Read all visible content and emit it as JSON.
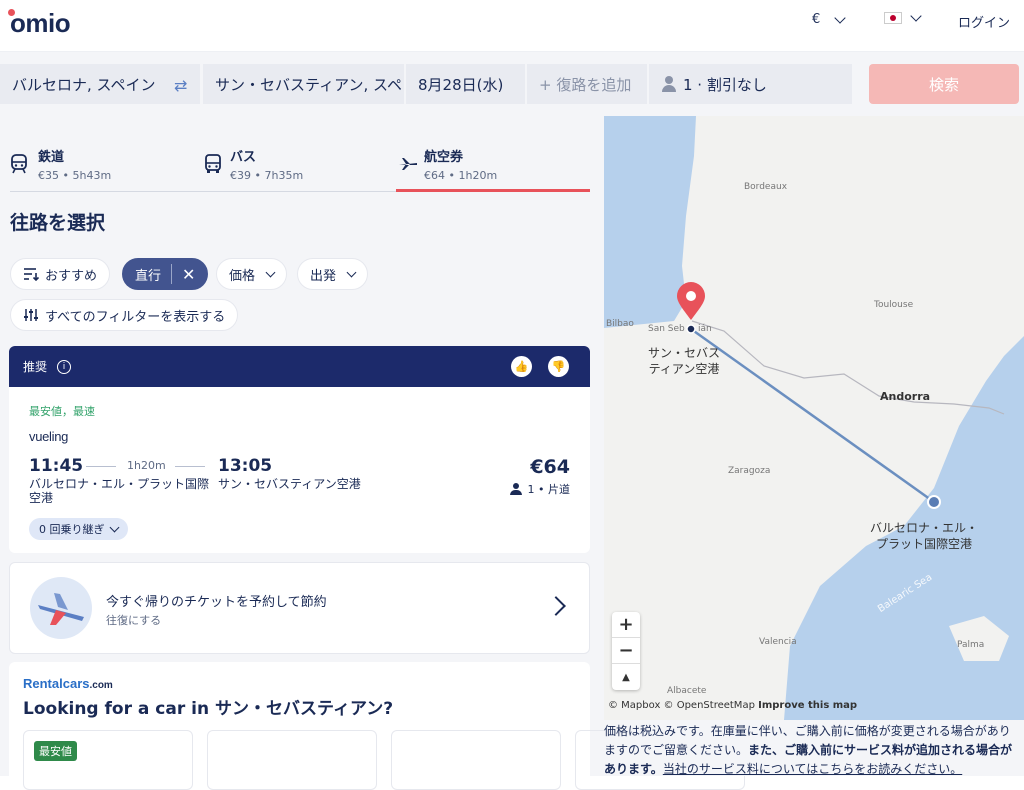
{
  "header": {
    "logo": "omio",
    "currency": "€",
    "login": "ログイン"
  },
  "search": {
    "from": "バルセロナ, スペイン",
    "to": "サン・セバスティアン, スペ",
    "date": "8月28日(水)",
    "return_placeholder": "+ 復路を追加",
    "passengers": "1 · 割引なし",
    "button": "検索"
  },
  "tabs": [
    {
      "title": "鉄道",
      "sub": "€35 • 5h43m",
      "icon": "train-icon"
    },
    {
      "title": "バス",
      "sub": "€39 • 7h35m",
      "icon": "bus-icon"
    },
    {
      "title": "航空券",
      "sub": "€64 • 1h20m",
      "icon": "plane-icon"
    }
  ],
  "heading": "往路を選択",
  "filters": {
    "recommended": "おすすめ",
    "direct": "直行",
    "price": "価格",
    "departure": "出発",
    "all_filters": "すべてのフィルターを表示する"
  },
  "result": {
    "header_label": "推奨",
    "tag": "最安値，最速",
    "airline": "vueling",
    "depart_time": "11:45",
    "duration": "1h20m",
    "arrive_time": "13:05",
    "depart_station": "バルセロナ・エル・プラット国際空港",
    "arrive_station": "サン・セバスティアン空港",
    "price": "€64",
    "pax": "1 • 片道",
    "stops": "0 回乗り継ぎ"
  },
  "roundtrip": {
    "title": "今すぐ帰りのチケットを予約して節約",
    "sub": "往復にする"
  },
  "rentalcars": {
    "logo": "Rentalcars",
    "logo_suffix": ".com",
    "title": "Looking for a car in サン・セバスティアン?",
    "badge": "最安値"
  },
  "map": {
    "cities": {
      "bordeaux": "Bordeaux",
      "toulouse": "Toulouse",
      "bilbao": "Bilbao",
      "san_seb": "San Seb",
      "san_seb_b": "ián",
      "andorra": "Andorra",
      "zaragoza": "Zaragoza",
      "valencia": "Valencia",
      "palma": "Palma",
      "albacete": "Albacete",
      "balearic": "Balearic Sea"
    },
    "origin_label_1": "サン・セバス",
    "origin_label_2": "ティアン空港",
    "dest_label_1": "バルセロナ・エル・",
    "dest_label_2": "プラット国際空港",
    "zoom_in": "+",
    "zoom_out": "−",
    "compass": "▲",
    "attribution": "© Mapbox © OpenStreetMap",
    "improve": "Improve this map"
  },
  "disclaimer": {
    "p1": "価格は税込みです。在庫量に伴い、ご購入前に価格が変更される場合があり",
    "p2": "ますのでご留意ください。",
    "p2_bold": "また、ご購入前にサービス料が追加される場合が",
    "p3_bold": "あります。",
    "p3_link": "当社のサービス料についてはこちらをお読みください。"
  },
  "colors": {
    "brand_navy": "#1a2a55",
    "accent": "#e8525a",
    "route": "#6b8fc0"
  }
}
